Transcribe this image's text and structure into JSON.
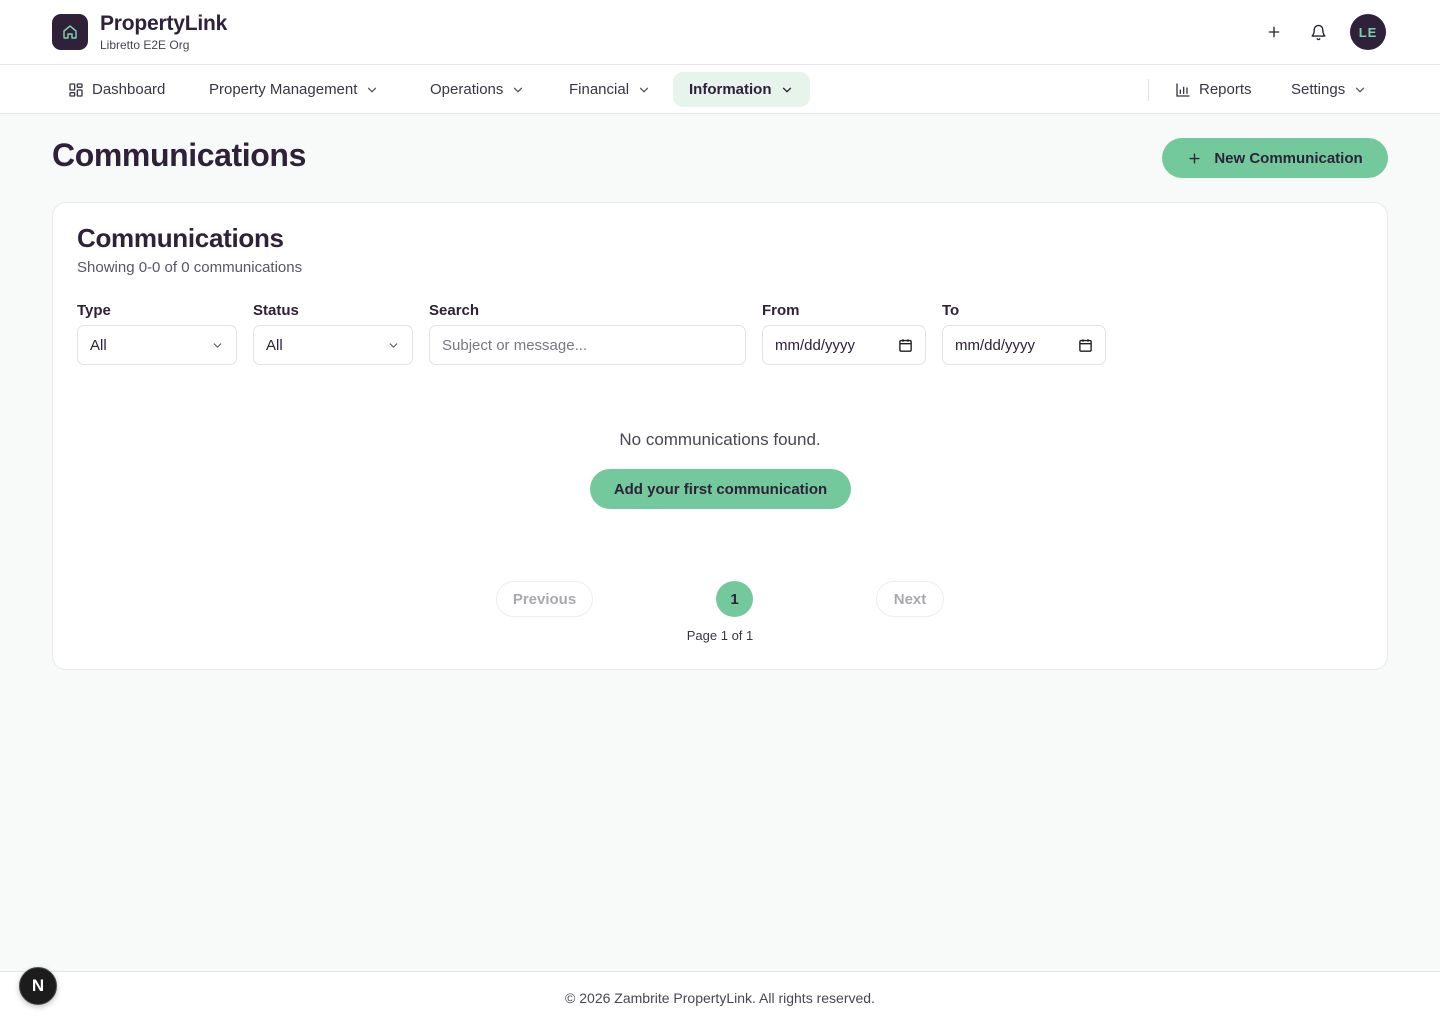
{
  "colors": {
    "brand_dark": "#2e2139",
    "accent": "#74c99c",
    "accent_light": "#e6f4ec"
  },
  "header": {
    "app_name": "PropertyLink",
    "org_name": "Libretto E2E Org",
    "avatar_initials": "LE",
    "icons": [
      "home-icon",
      "plus-icon",
      "bell-icon"
    ]
  },
  "nav": {
    "dashboard": "Dashboard",
    "property_management": "Property Management",
    "operations": "Operations",
    "financial": "Financial",
    "information": "Information",
    "reports": "Reports",
    "settings": "Settings"
  },
  "page": {
    "title": "Communications",
    "new_button": "New Communication"
  },
  "card": {
    "title": "Communications",
    "subtitle": "Showing 0-0 of 0 communications",
    "filters": {
      "type_label": "Type",
      "type_value": "All",
      "status_label": "Status",
      "status_value": "All",
      "search_label": "Search",
      "search_placeholder": "Subject or message...",
      "from_label": "From",
      "from_placeholder": "mm/dd/yyyy",
      "to_label": "To",
      "to_placeholder": "mm/dd/yyyy"
    },
    "empty_message": "No communications found.",
    "add_first_button": "Add your first communication",
    "pagination": {
      "previous": "Previous",
      "current_page": "1",
      "next": "Next",
      "page_of": "Page 1 of 1"
    }
  },
  "footer": {
    "copyright": "© 2026 Zambrite PropertyLink. All rights reserved.",
    "badge_letter": "N"
  }
}
